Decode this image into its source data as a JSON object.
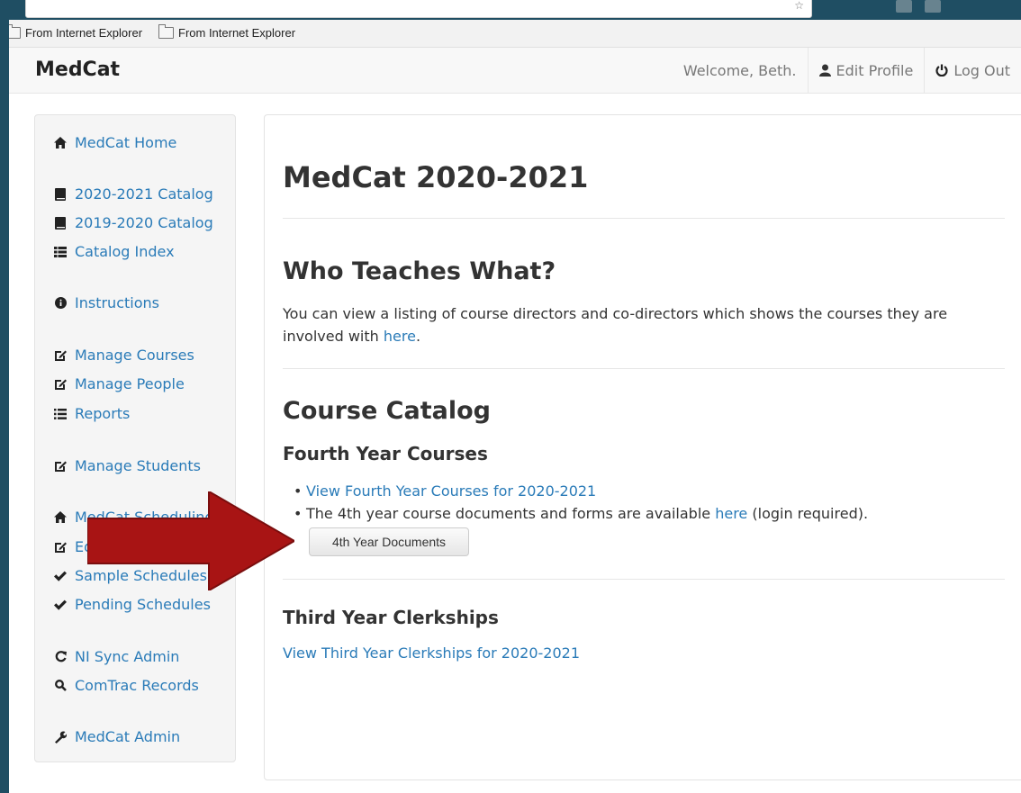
{
  "browser": {
    "bookmarks": [
      "From Internet Explorer",
      "From Internet Explorer"
    ]
  },
  "navbar": {
    "brand": "MedCat",
    "welcome": "Welcome, Beth.",
    "edit_profile": "Edit Profile",
    "logout": "Log Out"
  },
  "sidebar": {
    "items": [
      {
        "label": "MedCat Home",
        "icon": "home-icon"
      },
      {
        "label": "2020-2021 Catalog",
        "icon": "book-icon"
      },
      {
        "label": "2019-2020 Catalog",
        "icon": "book-icon"
      },
      {
        "label": "Catalog Index",
        "icon": "th-list-icon"
      },
      {
        "label": "Instructions",
        "icon": "info-circle-icon"
      },
      {
        "label": "Manage Courses",
        "icon": "edit-icon"
      },
      {
        "label": "Manage People",
        "icon": "edit-icon"
      },
      {
        "label": "Reports",
        "icon": "list-icon"
      },
      {
        "label": "Manage Students",
        "icon": "edit-icon"
      },
      {
        "label": "MedCat Scheduling",
        "icon": "home-icon"
      },
      {
        "label": "Edit",
        "icon": "edit-icon"
      },
      {
        "label": "Sample Schedules",
        "icon": "check-icon"
      },
      {
        "label": "Pending Schedules",
        "icon": "check-icon"
      },
      {
        "label": "NI Sync Admin",
        "icon": "sync-icon"
      },
      {
        "label": "ComTrac Records",
        "icon": "search-icon"
      },
      {
        "label": "MedCat Admin",
        "icon": "wrench-icon"
      }
    ]
  },
  "main": {
    "title": "MedCat 2020-2021",
    "who_heading": "Who Teaches What?",
    "who_text": "You can view a listing of course directors and co-directors which shows the courses they are involved with",
    "who_link": "here",
    "catalog_heading": "Course Catalog",
    "fourth_heading": "Fourth Year Courses",
    "fourth_link": "View Fourth Year Courses for 2020-2021",
    "docs_text_before": "The 4th year course documents and forms are available",
    "docs_link": "here",
    "docs_text_after": "(login required).",
    "docs_button": "4th Year Documents",
    "third_heading": "Third Year Clerkships",
    "third_link": "View Third Year Clerkships for 2020-2021"
  },
  "colors": {
    "link": "#2a7bb8",
    "arrow": "#a81414",
    "slide_bg": "#1f4e63"
  }
}
